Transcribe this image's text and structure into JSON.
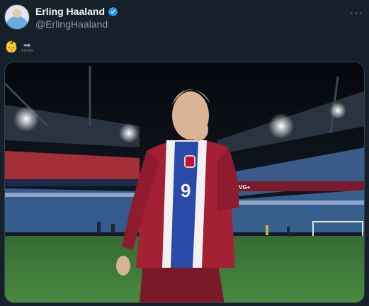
{
  "author": {
    "name": "Erling Haaland",
    "handle": "@ErlingHaaland",
    "verified_icon": "verified-badge-icon",
    "avatar_icon": "profile-avatar"
  },
  "menu": {
    "more_label": "···"
  },
  "tweet": {
    "emoji": "👶",
    "arrow": "➡",
    "arrow_caption": "SOON"
  },
  "media": {
    "description_icon": "photo-stadium-player",
    "jersey_number": "9",
    "advertising_text": "VG+"
  },
  "colors": {
    "background": "#15202b",
    "verified": "#1d9bf0",
    "secondary_text": "#8b98a5",
    "jersey_red": "#a32035",
    "jersey_blue": "#2a4aa8",
    "pitch_green": "#3f7a3a"
  }
}
